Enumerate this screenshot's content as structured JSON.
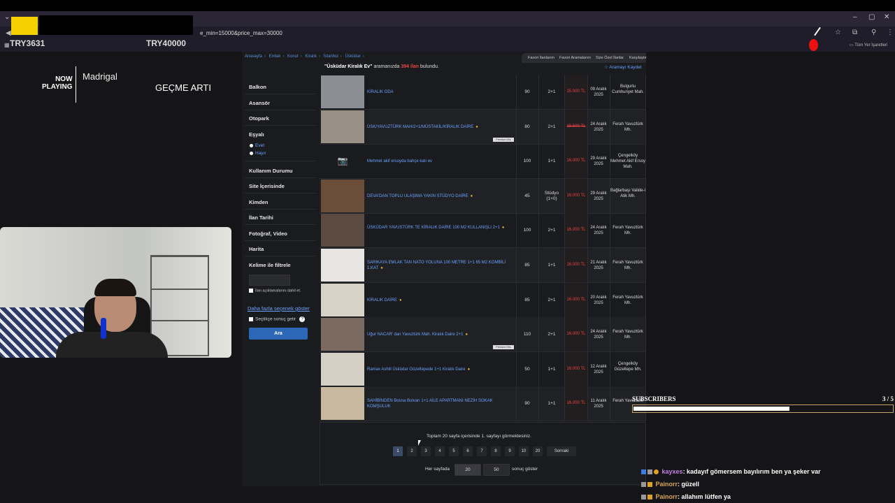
{
  "browser": {
    "url": "e_min=15000&price_max=30000",
    "bookmarks_label": "Tüm Yer İşaretleri"
  },
  "overlay": {
    "balance_left": "TRY3631",
    "balance_right": "TRY40000",
    "now_playing": {
      "label_top": "NOW",
      "label_bottom": "PLAYING",
      "artist": "Madrigal",
      "song": "GEÇME ARTI"
    }
  },
  "site": {
    "breadcrumb": [
      "Anasayfa",
      "Emlak",
      "Konut",
      "Kiralık",
      "İstanbul",
      "Üsküdar"
    ],
    "tabs": [
      "Favori İlanlarım",
      "Favori Aramalarım",
      "Size Özel İlanlar",
      "Karşılaştır"
    ],
    "result": {
      "query": "\"Üsküdar Kiralık Ev\"",
      "text_a": "aramanızda",
      "count": "394 ilan",
      "text_b": "bulundu."
    },
    "save_search": "Aramayı Kaydet",
    "filters": [
      "Balkon",
      "Asansör",
      "Otopark",
      "Eşyalı",
      "Kullanım Durumu",
      "Site İçerisinde",
      "Kimden",
      "İlan Tarihi",
      "Fotoğraf, Video",
      "Harita",
      "Kelime ile filtrele"
    ],
    "furnished_options": [
      "Evet",
      "Hayır"
    ],
    "include_desc": "İlan açıklamalarını dahil et.",
    "more_options": "Daha fazla seçenek göster",
    "selected_only": "Seçtikçe sonuç getir",
    "search_button": "Ara",
    "listings": [
      {
        "title": "KİRALIK ODA",
        "pin": false,
        "premium": false,
        "m2": "90",
        "rooms": "2+1",
        "price": "15.000 TL",
        "strike": false,
        "date": "09 Aralık 2025",
        "location": "Bulgurlu Cumhuriyet Mah."
      },
      {
        "title": "ÜSK/YAVUZTÜRK MAH/2+1/MÜSTAKİL/KİRALIK DAİRE",
        "pin": true,
        "premium": true,
        "m2": "80",
        "rooms": "2+1",
        "price": "15.500 TL",
        "strike": true,
        "date": "24 Aralık 2025",
        "location": "Ferah Yavuztürk Mh."
      },
      {
        "title": "Mehmet akif ersoyda bahçe katı ev",
        "pin": false,
        "premium": false,
        "m2": "100",
        "rooms": "1+1",
        "price": "16.000 TL",
        "strike": false,
        "date": "29 Aralık 2025",
        "location": "Çengelköy Mehmet Akif Ersoy Mah."
      },
      {
        "title": "DEVA'DAN TOPLU ULAŞIMA YAKIN STÜDYO DAİRE",
        "pin": true,
        "premium": false,
        "m2": "45",
        "rooms": "Stüdyo (1+0)",
        "price": "16.000 TL",
        "strike": false,
        "date": "29 Aralık 2025",
        "location": "Bağlarbaşı Valide-i Atik Mh."
      },
      {
        "title": "ÜSKÜDAR YAVUSTÜRK TE KİRALIK DAİRE 100 M2 KULLANIŞLI 2+1",
        "pin": true,
        "premium": false,
        "m2": "100",
        "rooms": "2+1",
        "price": "16.000 TL",
        "strike": false,
        "date": "24 Aralık 2025",
        "location": "Ferah Yavuztürk Mh."
      },
      {
        "title": "SARIKAYA EMLAK TAN NATO YOLUNA 100 METRE 1+1 65 M2 KOMBİLİ 1.KAT",
        "pin": true,
        "premium": false,
        "m2": "85",
        "rooms": "1+1",
        "price": "16.000 TL",
        "strike": false,
        "date": "21 Aralık 2025",
        "location": "Ferah Yavuztürk Mh."
      },
      {
        "title": "KİRALIK DAİRE",
        "pin": true,
        "premium": false,
        "m2": "85",
        "rooms": "2+1",
        "price": "16.000 TL",
        "strike": false,
        "date": "20 Aralık 2025",
        "location": "Ferah Yavuztürk Mh."
      },
      {
        "title": "Uğur NACAR' dan Yavuztürk Mah. Kiralık Daire 2+1",
        "pin": true,
        "premium": true,
        "m2": "110",
        "rooms": "2+1",
        "price": "16.000 TL",
        "strike": false,
        "date": "24 Aralık 2025",
        "location": "Ferah Yavuztürk Mh."
      },
      {
        "title": "Ramax Ashill Üsküdar Güzeltepede 1+1 Kiralık Daire",
        "pin": true,
        "premium": false,
        "m2": "50",
        "rooms": "1+1",
        "price": "16.000 TL",
        "strike": false,
        "date": "12 Aralık 2025",
        "location": "Çengelköy Güzeltepe Mh."
      },
      {
        "title": "SAHİBİNDEN Bosna Bulvarı 1+1 AİLE APARTMANI NEZİH SOKAK KOMŞULUK",
        "pin": false,
        "premium": false,
        "m2": "90",
        "rooms": "1+1",
        "price": "16.000 TL",
        "strike": false,
        "date": "11 Aralık 2025",
        "location": "Ferah Yavuztürk"
      }
    ],
    "premium_label": "Premium Ofis",
    "pagination": {
      "info": "Toplam 20 sayfa içerisinde 1. sayfayı görmektesiniz.",
      "pages": [
        "1",
        "2",
        "3",
        "4",
        "5",
        "6",
        "7",
        "8",
        "9",
        "10",
        "20"
      ],
      "next": "Sonraki",
      "per_page_label": "Her sayfada",
      "per_page_options": [
        "20",
        "50"
      ],
      "per_page_suffix": "sonuç göster"
    }
  },
  "stream": {
    "subscribers_label": "SUBSCRIBERS",
    "subscribers_count": "3  / 5",
    "subscribers_progress": 0.6,
    "chat": [
      {
        "user": "kayxes",
        "message": ": kadayıf gömersem bayılırım ben ya şeker var"
      },
      {
        "user": "Painorr",
        "message": ": güzell"
      },
      {
        "user": "Painorr",
        "message": ": allahım lütfen ya"
      }
    ]
  },
  "colors": {
    "link": "#6aa3ff",
    "price": "#e44444",
    "accent_button": "#2d68b8"
  }
}
